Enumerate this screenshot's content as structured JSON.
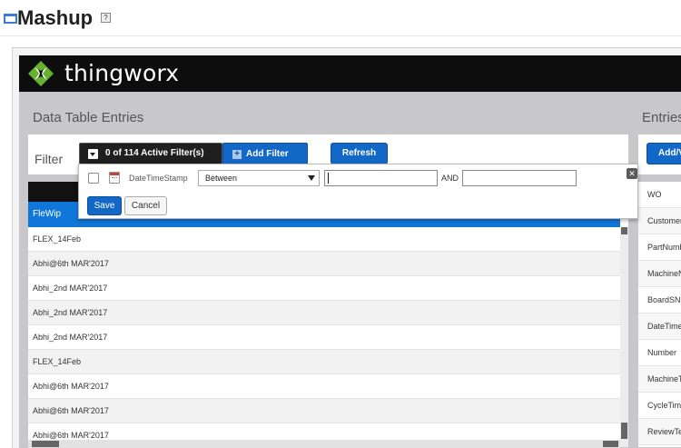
{
  "page": {
    "title": "Mashup",
    "help_icon": "help-icon",
    "mashup_icon": "mashup-window-icon"
  },
  "brand": {
    "name": "thingworx",
    "logo_icon": "thingworx-logo-icon",
    "bar_color": "#0d0d0d"
  },
  "left_section": {
    "title": "Data Table Entries",
    "filter_label": "Filter",
    "active_filters_text": "0 of 114 Active Filter(s)",
    "add_filter_label": "Add Filter",
    "refresh_label": "Refresh"
  },
  "right_section": {
    "title": "Entries",
    "add_button_label": "Add/V",
    "fields": [
      "WO",
      "CustomerName",
      "PartNumber",
      "MachineName",
      "BoardSN",
      "DateTimeStamp",
      "Number",
      "MachineType",
      "CycleTime",
      "ReviewTe"
    ]
  },
  "grid": {
    "column_header": "FleWip",
    "rows": [
      "FLEX_14Feb",
      "Abhi@6th MAR'2017",
      "Abhi_2nd MAR'2017",
      "Abhi_2nd MAR'2017",
      "Abhi_2nd MAR'2017",
      "FLEX_14Feb",
      "Abhi@6th MAR'2017",
      "Abhi@6th MAR'2017",
      "Abhi@6th MAR'2017"
    ]
  },
  "filter_popup": {
    "field_name": "DateTimeStamp",
    "operator": "Between",
    "value_from": "",
    "value_to": "",
    "and_label": "AND",
    "save_label": "Save",
    "cancel_label": "Cancel",
    "close_label": "✕"
  },
  "colors": {
    "accent_blue": "#1368c7",
    "grid_header_blue": "#1077d9",
    "content_gray": "#c8c7ca"
  }
}
